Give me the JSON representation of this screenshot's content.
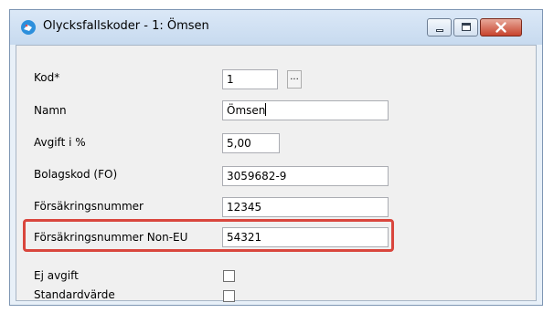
{
  "window": {
    "title": "Olycksfallskoder - 1: Ömsen",
    "app_icon": "app-icon"
  },
  "form": {
    "kod": {
      "label": "Kod*",
      "value": "1",
      "picker_label": "..."
    },
    "namn": {
      "label": "Namn",
      "value": "Ömsen"
    },
    "avgift": {
      "label": "Avgift i %",
      "value": "5,00"
    },
    "bolagskod": {
      "label": "Bolagskod (FO)",
      "value": "3059682-9"
    },
    "forsakringsnummer": {
      "label": "Försäkringsnummer",
      "value": "12345"
    },
    "forsakringsnummer_noneu": {
      "label": "Försäkringsnummer Non-EU",
      "value": "54321"
    },
    "ej_avgift": {
      "label": "Ej avgift",
      "checked": false
    },
    "standardvarde": {
      "label": "Standardvärde",
      "checked": false
    }
  },
  "colors": {
    "highlight": "#d9463d",
    "close_button": "#c7432d",
    "titlebar": "#c7daef"
  }
}
